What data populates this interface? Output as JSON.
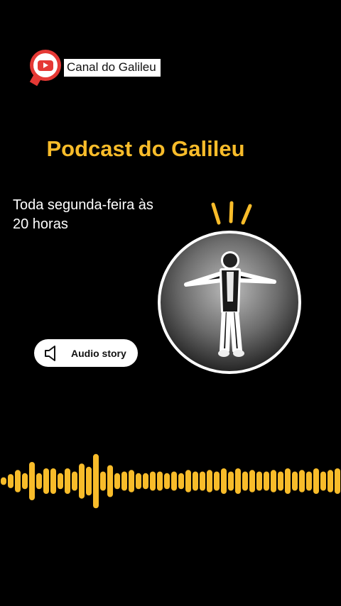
{
  "channel": {
    "name": "Canal do Galileu",
    "icon": "youtube-play-icon",
    "accent": "#e53935"
  },
  "title": "Podcast do Galileu",
  "schedule_line1": "Toda segunda-feira às",
  "schedule_line2": "20 horas",
  "audio_button": {
    "label": "Audio story",
    "icon": "speaker-icon"
  },
  "photo_icon": "person-photo",
  "colors": {
    "accent_yellow": "#f8bc2a",
    "background": "#000000"
  },
  "waveform_levels": [
    0.12,
    0.22,
    0.35,
    0.25,
    0.6,
    0.25,
    0.4,
    0.4,
    0.25,
    0.4,
    0.3,
    0.55,
    0.45,
    0.85,
    0.3,
    0.5,
    0.25,
    0.3,
    0.35,
    0.25,
    0.25,
    0.3,
    0.3,
    0.25,
    0.3,
    0.25,
    0.35,
    0.3,
    0.3,
    0.35,
    0.3,
    0.4,
    0.3,
    0.4,
    0.3,
    0.35,
    0.3,
    0.3,
    0.35,
    0.3,
    0.4,
    0.3,
    0.35,
    0.3,
    0.4,
    0.3,
    0.35,
    0.4
  ]
}
